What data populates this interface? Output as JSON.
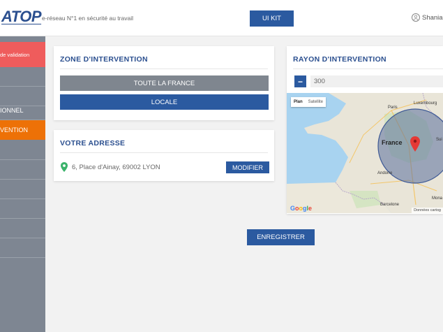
{
  "header": {
    "logo": "ATOP",
    "tagline": "e-réseau N°1 en sécurité au travail",
    "uikit_label": "UI KIT",
    "user_name": "Shania"
  },
  "sidebar": {
    "items": [
      {
        "label": "de validation"
      },
      {
        "label": ""
      },
      {
        "label": ""
      },
      {
        "label": "IONNEL"
      },
      {
        "label": "VENTION"
      },
      {
        "label": ""
      },
      {
        "label": ""
      },
      {
        "label": ""
      },
      {
        "label": ""
      },
      {
        "label": ""
      },
      {
        "label": ""
      }
    ]
  },
  "zone": {
    "title": "ZONE D'INTERVENTION",
    "option_all": "TOUTE LA FRANCE",
    "option_local": "LOCALE"
  },
  "address": {
    "title": "VOTRE ADRESSE",
    "value": "6, Place d'Ainay, 69002 LYON",
    "modify_label": "MODIFIER"
  },
  "radius": {
    "title": "RAYON D'INTERVENTION",
    "minus_label": "−",
    "value": "300"
  },
  "map": {
    "tab_plan": "Plan",
    "tab_satellite": "Satellite",
    "labels": {
      "luxembourg": "Luxembourg",
      "paris": "Paris",
      "france": "France",
      "andorre": "Andorre",
      "barcelone": "Barcelone",
      "monaco": "Mona",
      "suisse": "Sui"
    },
    "google": "Google",
    "credit": "Données cartog"
  },
  "actions": {
    "save_label": "ENREGISTRER"
  },
  "colors": {
    "primary": "#2b5aa0",
    "title": "#2b4f8f",
    "validation": "#ef5c5c",
    "active": "#ed7107",
    "sidebar": "#7e8692"
  }
}
